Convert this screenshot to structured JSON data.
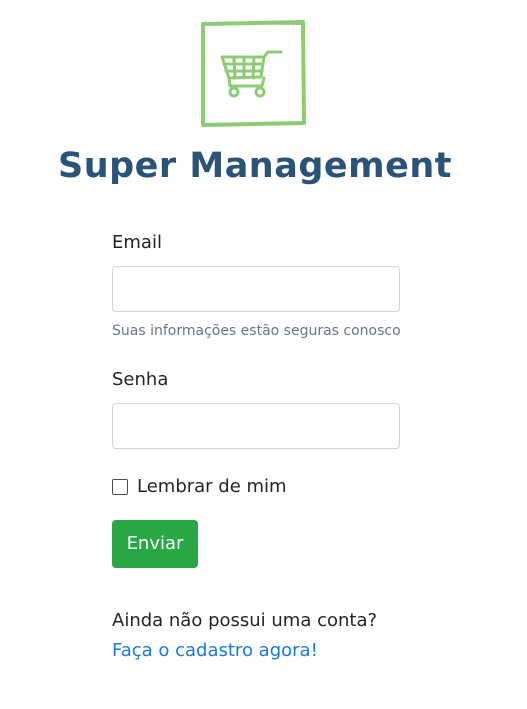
{
  "brand": {
    "title": "Super Management",
    "logo_icon": "shopping-cart-icon",
    "logo_color": "#8ccc74",
    "title_color": "#2b5378"
  },
  "form": {
    "email_label": "Email",
    "email_value": "",
    "email_help": "Suas informações estão seguras conosco",
    "password_label": "Senha",
    "password_value": "",
    "remember_label": "Lembrar de mim",
    "remember_checked": false,
    "submit_label": "Enviar",
    "submit_color": "#28a745"
  },
  "signup": {
    "prompt": "Ainda não possui uma conta?",
    "link_label": "Faça o cadastro agora!",
    "link_color": "#1a78e6"
  }
}
